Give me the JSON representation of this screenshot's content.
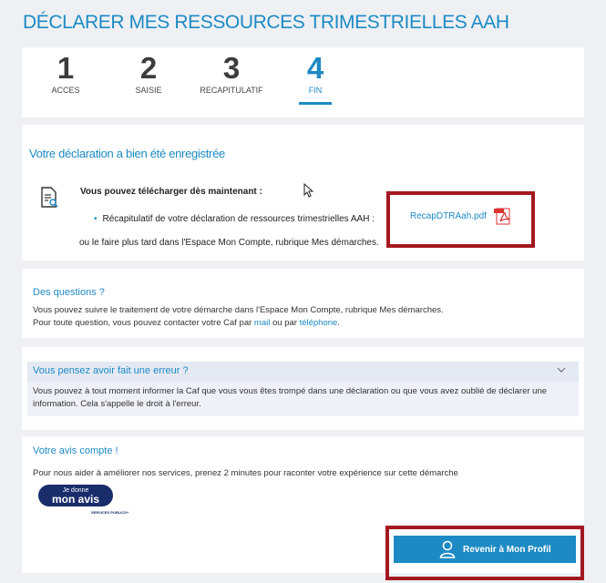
{
  "page": {
    "title": "DÉCLARER MES RESSOURCES TRIMESTRIELLES AAH"
  },
  "steps": [
    {
      "num": "1",
      "label": "ACCES"
    },
    {
      "num": "2",
      "label": "SAISIE"
    },
    {
      "num": "3",
      "label": "RECAPITULATIF"
    },
    {
      "num": "4",
      "label": "FIN",
      "active": true
    }
  ],
  "confirmation": {
    "heading": "Votre déclaration a bien été enregistrée",
    "download_title": "Vous pouvez télécharger dès maintenant :",
    "bullet": "Récapitulatif de votre déclaration de ressources trimestrielles AAH :",
    "pdf_link": "RecapDTRAah.pdf",
    "later_text": "ou le faire plus tard dans l'Espace Mon Compte, rubrique Mes démarches."
  },
  "questions": {
    "heading": "Des questions ?",
    "line1": "Vous pouvez suivre le traitement de votre démarche dans l'Espace Mon Compte, rubrique Mes démarches.",
    "line2_prefix": "Pour toute question, vous pouvez contacter votre Caf par ",
    "link_mail": "mail",
    "line2_mid": " ou par ",
    "link_phone": "téléphone",
    "line2_suffix": "."
  },
  "error": {
    "heading": "Vous pensez avoir fait une erreur ?",
    "body": "Vous pouvez à tout moment informer la Caf que vous vous êtes trompé dans une déclaration ou que vous avez oublié de déclarer une information. Cela s'appelle le droit à l'erreur."
  },
  "avis": {
    "heading": "Votre avis compte !",
    "text": "Pour nous aider à améliorer nos services, prenez 2 minutes pour raconter votre expérience sur cette démarche",
    "badge_small": "Je donne",
    "badge_big": "mon avis",
    "badge_sub": "SERVICES PUBLICS+"
  },
  "profile_button": {
    "label": "Revenir à Mon Profil"
  },
  "colors": {
    "accent": "#1d8ac4",
    "highlight_border": "#a31820",
    "badge": "#1a2d6b"
  }
}
